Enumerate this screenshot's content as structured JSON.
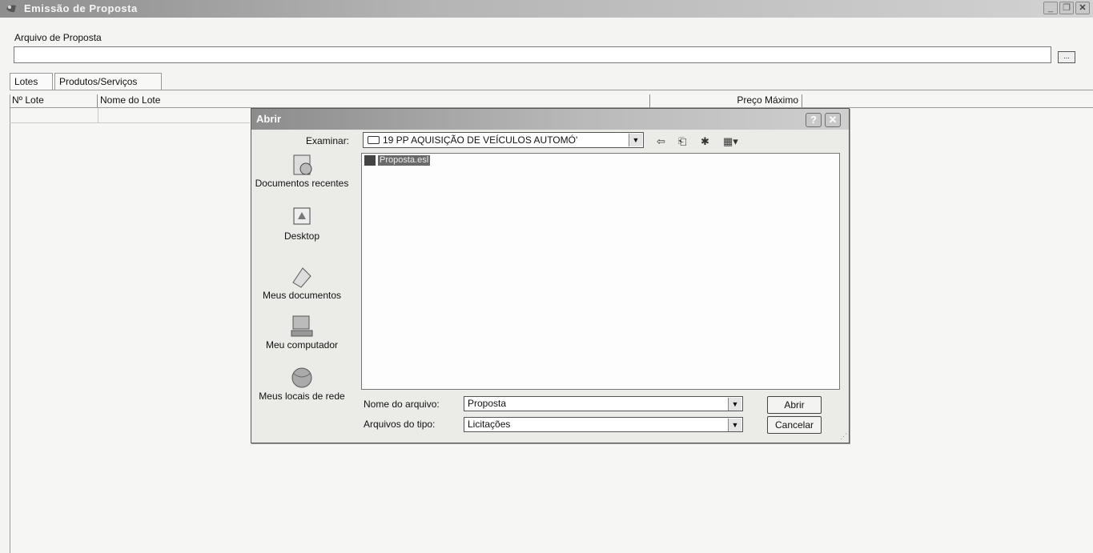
{
  "window": {
    "title": "Emissão de Proposta",
    "field_label": "Arquivo de Proposta",
    "file_value": "",
    "browse_label": "...",
    "tabs": [
      "Lotes",
      "Produtos/Serviços"
    ],
    "columns": [
      "Nº Lote",
      "Nome do Lote",
      "Preço Máximo"
    ]
  },
  "dialog": {
    "title": "Abrir",
    "help_glyph": "?",
    "close_glyph": "✕",
    "lookin_label": "Examinar:",
    "lookin_value": "19 PP AQUISIÇÃO DE VEÍCULOS AUTOMÓ'",
    "places": [
      "Documentos recentes",
      "Desktop",
      "Meus documentos",
      "Meu computador",
      "Meus locais de rede"
    ],
    "files": [
      {
        "name": "Proposta.esl",
        "selected": true
      }
    ],
    "filename_label": "Nome do arquivo:",
    "filename_value": "Proposta",
    "filetype_label": "Arquivos do tipo:",
    "filetype_value": "Licitações",
    "open_button": "Abrir",
    "cancel_button": "Cancelar"
  },
  "icons": [
    "app-icon",
    "minimize-icon",
    "restore-icon",
    "close-icon",
    "folder-icon",
    "back-icon",
    "up-folder-icon",
    "new-folder-icon",
    "views-menu-icon",
    "recent-documents-icon",
    "desktop-icon",
    "my-documents-icon",
    "my-computer-icon",
    "network-places-icon",
    "file-icon"
  ]
}
